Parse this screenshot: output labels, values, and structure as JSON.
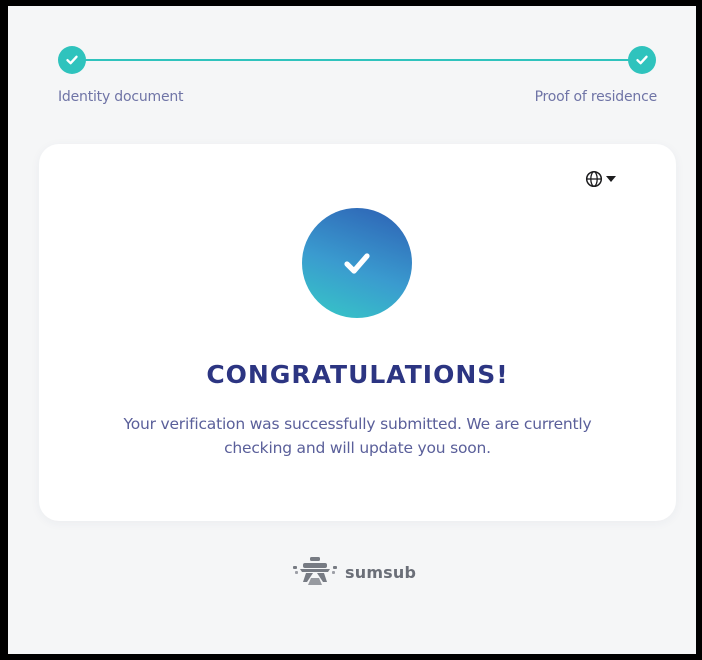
{
  "stepper": {
    "steps": [
      {
        "label": "Identity document",
        "status": "complete"
      },
      {
        "label": "Proof of residence",
        "status": "complete"
      }
    ],
    "accent_color": "#2fc3bd"
  },
  "card": {
    "language_selector_icon": "globe-icon",
    "success_icon": "checkmark-icon",
    "heading": "CONGRATULATIONS!",
    "message": "Your verification was successfully submitted. We are currently checking and will update you soon.",
    "heading_color": "#2c3582",
    "message_color": "#5a5f9a"
  },
  "footer": {
    "brand_name": "sumsub",
    "brand_icon": "sumsub-logo-icon"
  }
}
